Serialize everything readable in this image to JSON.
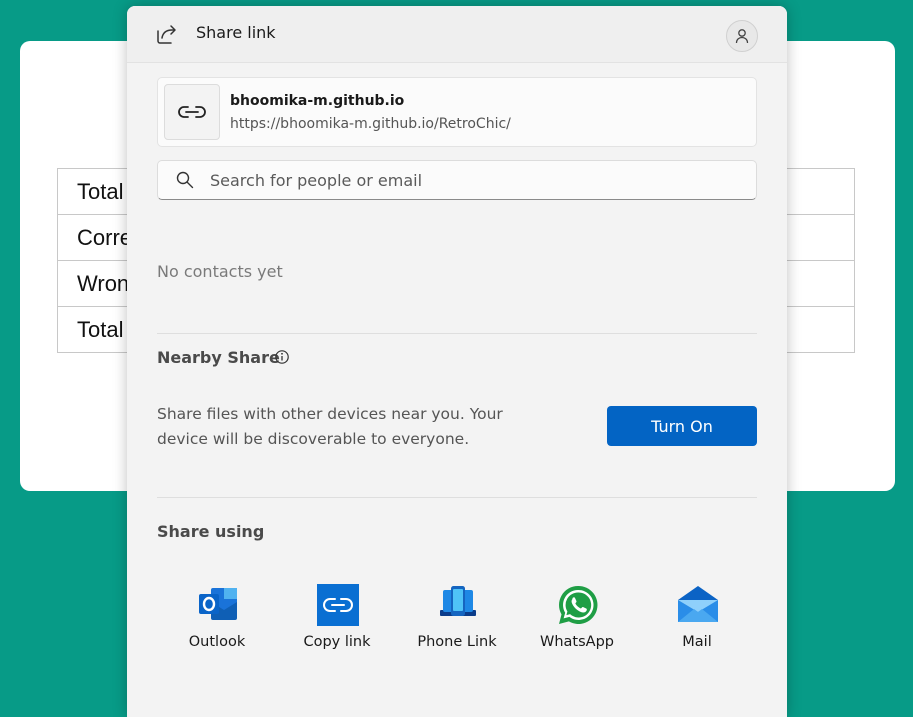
{
  "background": {
    "table_rows": [
      "Total",
      "Corre",
      "Wron",
      "Total"
    ]
  },
  "dialog": {
    "title": "Share link",
    "icon": "share-icon",
    "profile_icon": "person-icon"
  },
  "link": {
    "title": "bhoomika-m.github.io",
    "url": "https://bhoomika-m.github.io/RetroChic/",
    "icon": "link-icon"
  },
  "search": {
    "placeholder": "Search for people or email",
    "value": ""
  },
  "contacts": {
    "empty_text": "No contacts yet"
  },
  "nearby": {
    "title": "Nearby Share",
    "description": "Share files with other devices near you. Your device will be discoverable to everyone.",
    "button_label": "Turn On"
  },
  "share_using": {
    "title": "Share using",
    "apps": [
      {
        "label": "Outlook",
        "icon": "outlook-icon"
      },
      {
        "label": "Copy link",
        "icon": "copy-link-icon"
      },
      {
        "label": "Phone Link",
        "icon": "phone-link-icon"
      },
      {
        "label": "WhatsApp",
        "icon": "whatsapp-icon"
      },
      {
        "label": "Mail",
        "icon": "mail-icon"
      }
    ]
  },
  "colors": {
    "page_background": "#079b87",
    "accent": "#0364c4",
    "dialog_background": "#f3f3f3"
  }
}
